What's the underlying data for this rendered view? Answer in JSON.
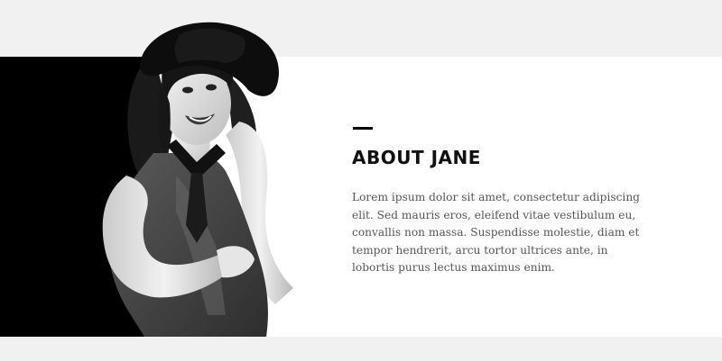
{
  "about": {
    "heading": "ABOUT JANE",
    "paragraph": "Lorem ipsum dolor sit amet, consectetur adipiscing elit. Sed mauris eros, eleifend vitae vestibulum eu, convallis non massa. Suspendisse molestie, diam et tempor hendrerit, arcu tortor ultrices ante, in lobortis purus lectus maximus enim."
  },
  "colors": {
    "page_background": "#f1f1f1",
    "content_background": "#ffffff",
    "accent_block": "#000000",
    "heading_text": "#111111",
    "body_text": "#555555"
  },
  "image": {
    "subject": "portrait-photo",
    "style": "black-and-white"
  }
}
